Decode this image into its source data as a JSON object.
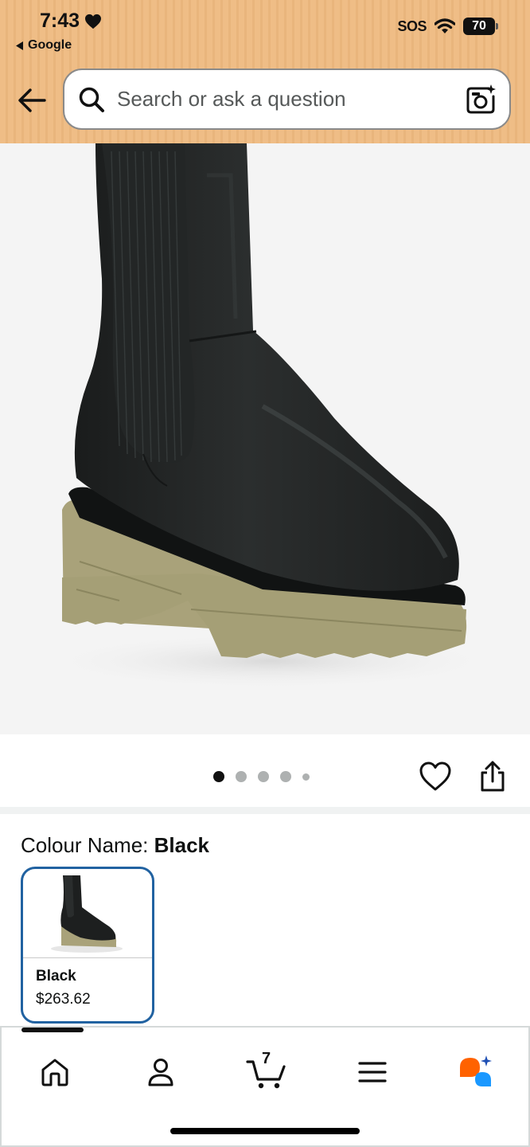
{
  "status_bar": {
    "time": "7:43",
    "back_app": "Google",
    "sos": "SOS",
    "battery": "70"
  },
  "search": {
    "placeholder": "Search or ask a question"
  },
  "product": {
    "image_alt": "black leather chelsea boot",
    "carousel": {
      "total_images": 5,
      "active_index": 0
    }
  },
  "colour": {
    "label": "Colour Name: ",
    "selected": "Black",
    "options": [
      {
        "name": "Black",
        "price": "$263.62"
      }
    ]
  },
  "nav": {
    "items": [
      "home-icon",
      "account-icon",
      "cart-icon",
      "menu-icon",
      "rufus-icon"
    ],
    "cart_count": "7"
  },
  "colors": {
    "header_bg": "#efbd86",
    "selected_border": "#2162a1",
    "rufus_orange": "#ff6200",
    "rufus_blue": "#1a98ff"
  }
}
